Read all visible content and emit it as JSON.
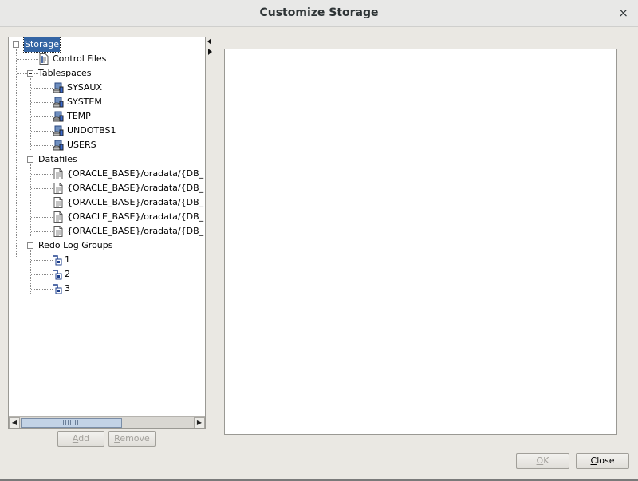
{
  "window": {
    "title": "Customize Storage",
    "close_glyph": "×"
  },
  "tree": {
    "root": "Storage",
    "items": [
      {
        "label": "Control Files",
        "icon": "control-file-icon"
      },
      {
        "label": "Tablespaces"
      },
      {
        "label": "SYSAUX",
        "icon": "tablespace-icon"
      },
      {
        "label": "SYSTEM",
        "icon": "tablespace-icon"
      },
      {
        "label": "TEMP",
        "icon": "tablespace-icon"
      },
      {
        "label": "UNDOTBS1",
        "icon": "tablespace-icon"
      },
      {
        "label": "USERS",
        "icon": "tablespace-icon"
      },
      {
        "label": "Datafiles"
      },
      {
        "label": "{ORACLE_BASE}/oradata/{DB_",
        "icon": "datafile-icon"
      },
      {
        "label": "{ORACLE_BASE}/oradata/{DB_",
        "icon": "datafile-icon"
      },
      {
        "label": "{ORACLE_BASE}/oradata/{DB_",
        "icon": "datafile-icon"
      },
      {
        "label": "{ORACLE_BASE}/oradata/{DB_",
        "icon": "datafile-icon"
      },
      {
        "label": "{ORACLE_BASE}/oradata/{DB_",
        "icon": "datafile-icon"
      },
      {
        "label": "Redo Log Groups"
      },
      {
        "label": "1",
        "icon": "redo-log-group-icon"
      },
      {
        "label": "2",
        "icon": "redo-log-group-icon"
      },
      {
        "label": "3",
        "icon": "redo-log-group-icon"
      }
    ]
  },
  "buttons": {
    "add": {
      "mnemonic": "A",
      "rest": "dd",
      "enabled": false
    },
    "remove": {
      "mnemonic": "R",
      "rest": "emove",
      "enabled": false
    },
    "ok": {
      "mnemonic": "O",
      "rest": "K",
      "enabled": false
    },
    "close": {
      "mnemonic": "C",
      "rest": "lose",
      "enabled": true
    }
  },
  "colors": {
    "selection": "#3465a4",
    "background": "#eae8e3"
  }
}
